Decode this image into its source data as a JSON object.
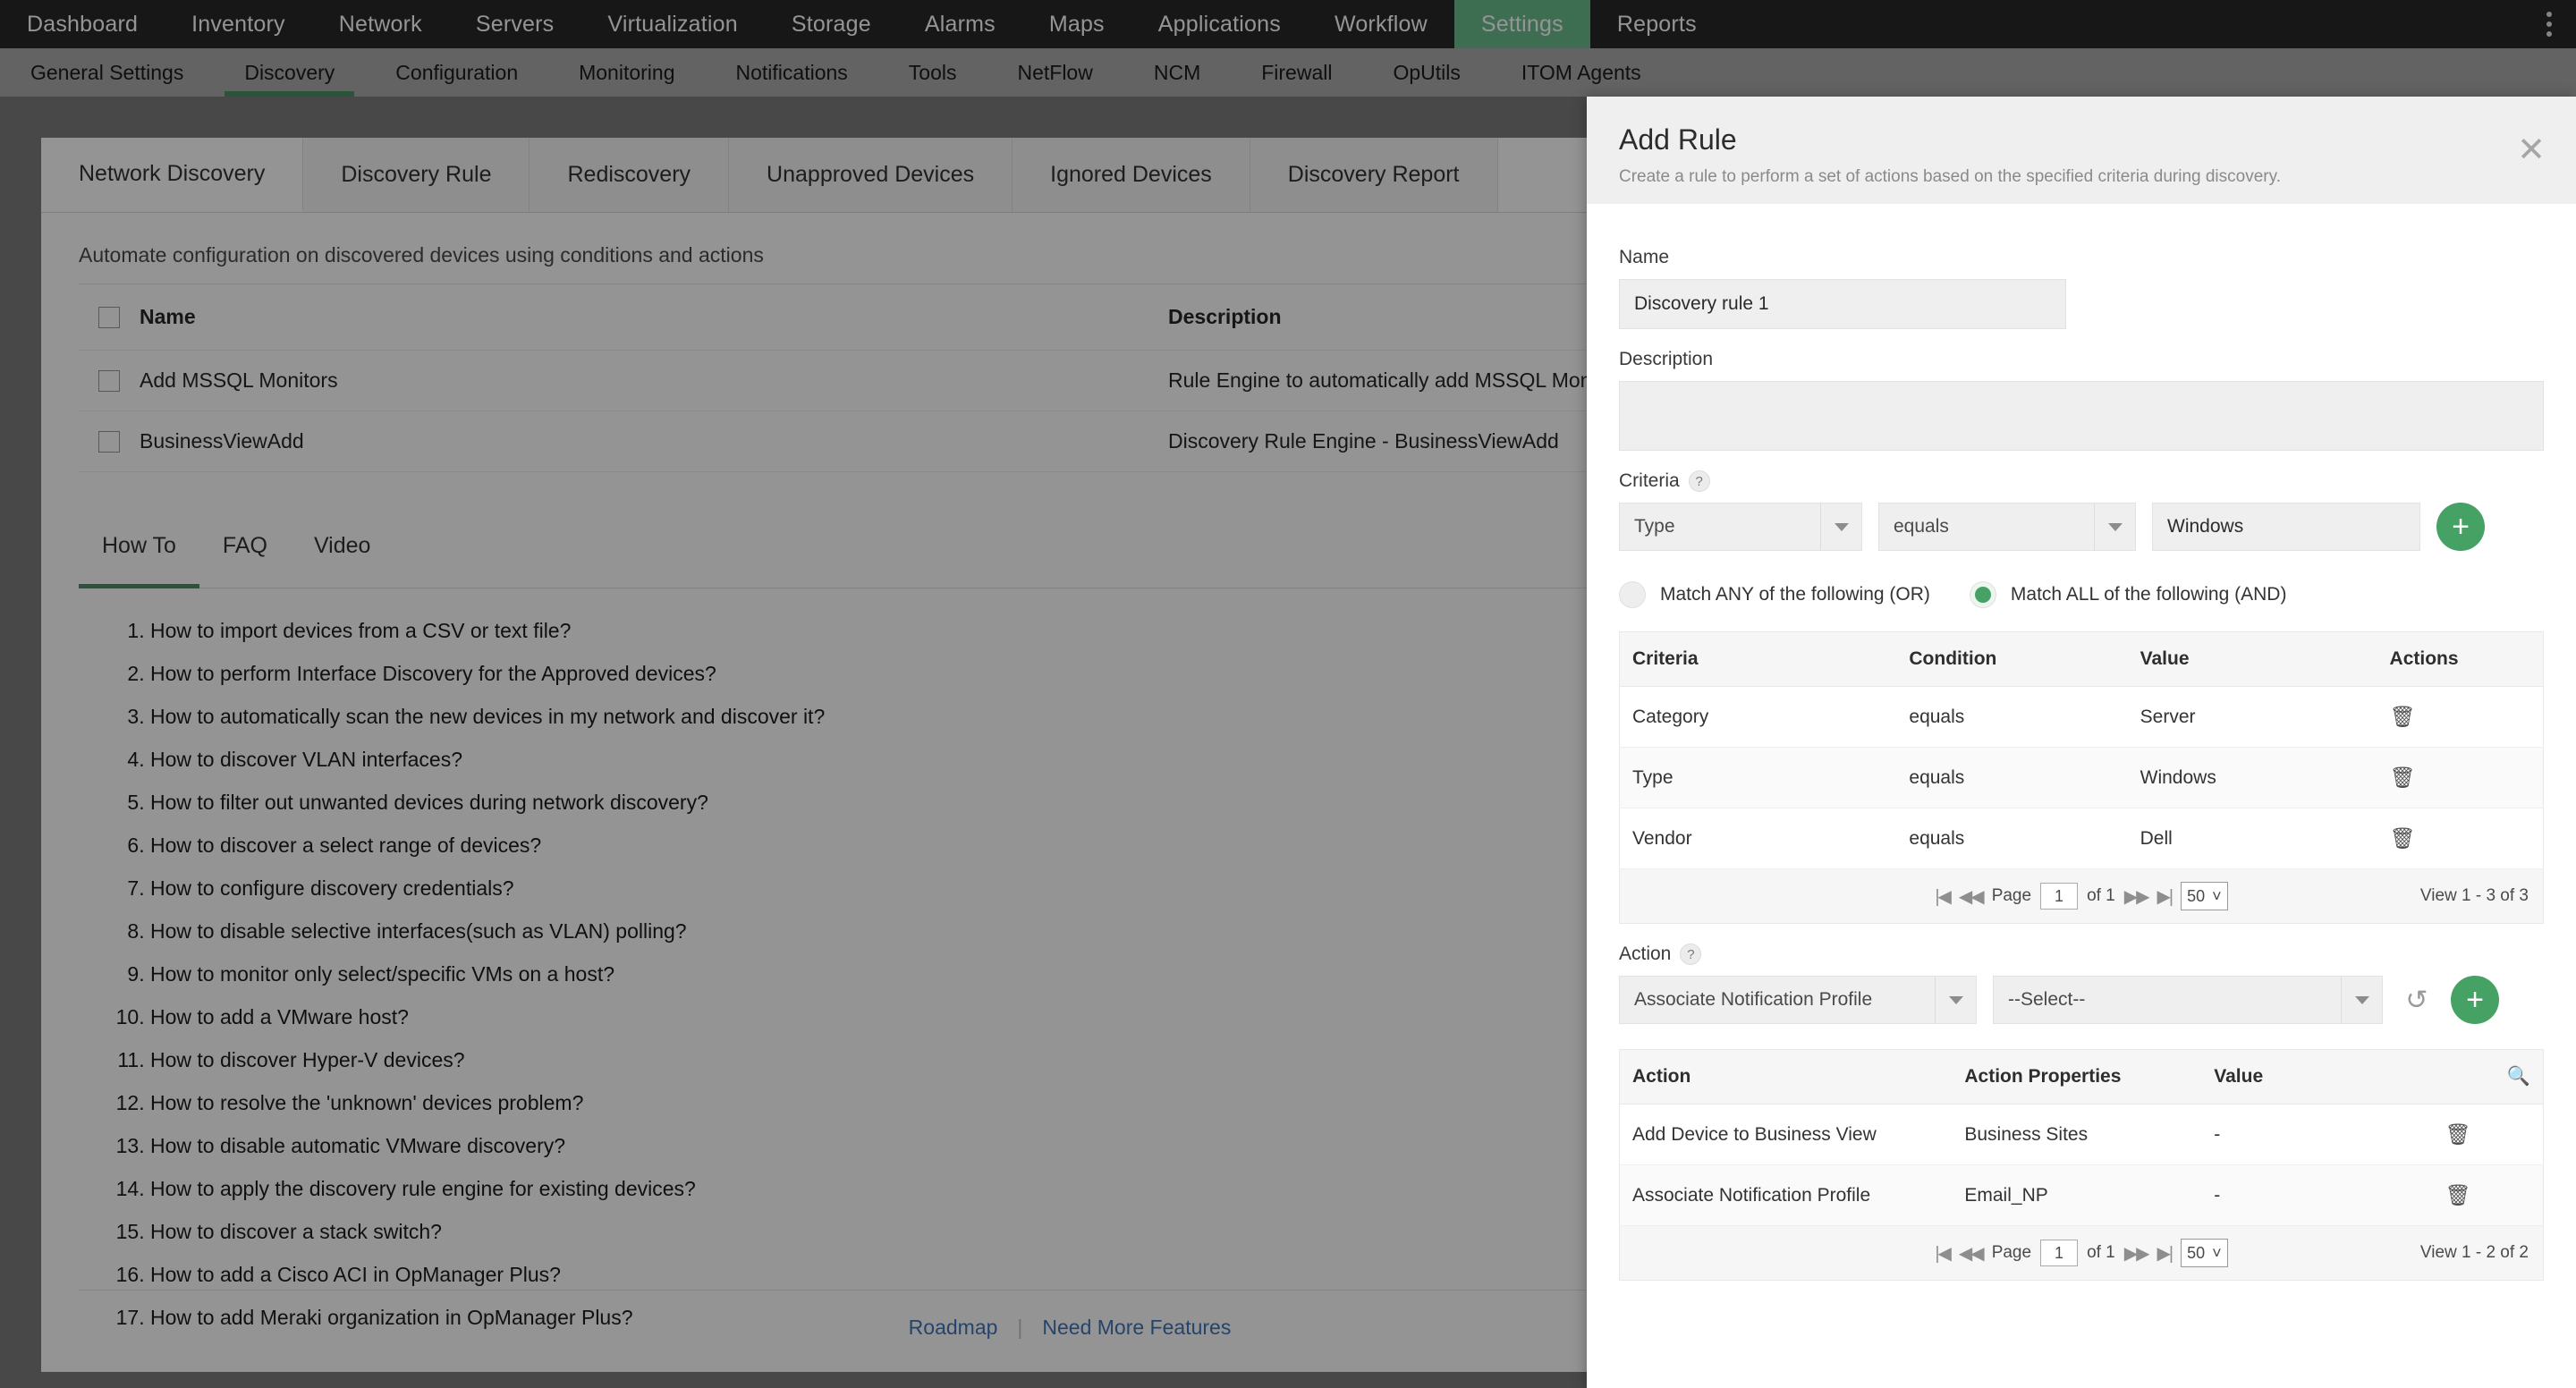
{
  "topnav": {
    "items": [
      {
        "label": "Dashboard",
        "active": false
      },
      {
        "label": "Inventory",
        "active": false
      },
      {
        "label": "Network",
        "active": false
      },
      {
        "label": "Servers",
        "active": false
      },
      {
        "label": "Virtualization",
        "active": false
      },
      {
        "label": "Storage",
        "active": false
      },
      {
        "label": "Alarms",
        "active": false
      },
      {
        "label": "Maps",
        "active": false
      },
      {
        "label": "Applications",
        "active": false
      },
      {
        "label": "Workflow",
        "active": false
      },
      {
        "label": "Settings",
        "active": true
      },
      {
        "label": "Reports",
        "active": false
      }
    ],
    "active_color": "#6cbe8e",
    "menu_icon": "kebab-menu-icon"
  },
  "subnav": {
    "items": [
      {
        "label": "General Settings",
        "active": false
      },
      {
        "label": "Discovery",
        "active": true
      },
      {
        "label": "Configuration",
        "active": false
      },
      {
        "label": "Monitoring",
        "active": false
      },
      {
        "label": "Notifications",
        "active": false
      },
      {
        "label": "Tools",
        "active": false
      },
      {
        "label": "NetFlow",
        "active": false
      },
      {
        "label": "NCM",
        "active": false
      },
      {
        "label": "Firewall",
        "active": false
      },
      {
        "label": "OpUtils",
        "active": false
      },
      {
        "label": "ITOM Agents",
        "active": false
      }
    ],
    "indicator_color": "#4d9167"
  },
  "content_tabs": [
    {
      "label": "Network Discovery",
      "active": true
    },
    {
      "label": "Discovery Rule",
      "active": false
    },
    {
      "label": "Rediscovery",
      "active": false
    },
    {
      "label": "Unapproved Devices",
      "active": false
    },
    {
      "label": "Ignored Devices",
      "active": false
    },
    {
      "label": "Discovery Report",
      "active": false
    }
  ],
  "main": {
    "subtitle": "Automate configuration on discovered devices using conditions and actions",
    "rules_table": {
      "headers": [
        "Name",
        "Description"
      ],
      "rows": [
        {
          "name": "Add MSSQL Monitors",
          "description": "Rule Engine to automatically add MSSQL Monitors"
        },
        {
          "name": "BusinessViewAdd",
          "description": "Discovery Rule Engine - BusinessViewAdd"
        }
      ]
    },
    "helper_tabs": [
      {
        "label": "How To",
        "active": true
      },
      {
        "label": "FAQ",
        "active": false
      },
      {
        "label": "Video",
        "active": false
      }
    ],
    "collapse_button": {
      "name": "minus-button",
      "color": "#7b2d2b"
    },
    "howto_items": [
      "How to import devices from a CSV or text file?",
      "How to perform Interface Discovery for the Approved devices?",
      "How to automatically scan the new devices in my network and discover it?",
      "How to discover VLAN interfaces?",
      "How to filter out unwanted devices during network discovery?",
      "How to discover a select range of devices?",
      "How to configure discovery credentials?",
      "How to disable selective interfaces(such as VLAN) polling?",
      "How to monitor only select/specific VMs on a host?",
      "How to add a VMware host?",
      "How to discover Hyper-V devices?",
      "How to resolve the 'unknown' devices problem?",
      "How to disable automatic VMware discovery?",
      "How to apply the discovery rule engine for existing devices?",
      "How to discover a stack switch?",
      "How to add a Cisco ACI in OpManager Plus?",
      "How to add Meraki organization in OpManager Plus?"
    ],
    "footer_links": [
      "Roadmap",
      "Need More Features"
    ],
    "footer_separator": "|"
  },
  "panel": {
    "title": "Add Rule",
    "subtitle": "Create a rule to perform a set of actions based on the specified criteria during discovery.",
    "close_icon": "close-icon",
    "name_label": "Name",
    "name_value": "Discovery rule 1",
    "description_label": "Description",
    "description_value": "",
    "criteria_label": "Criteria",
    "help_icon": "?",
    "criteria_field": "Type",
    "criteria_condition": "equals",
    "criteria_value": "Windows",
    "add_icon": "+",
    "match_any_label": "Match ANY of the following (OR)",
    "match_all_label": "Match ALL of the following (AND)",
    "match_selected": "all",
    "accent_color": "#45a164",
    "criteria_table": {
      "headers": [
        "Criteria",
        "Condition",
        "Value",
        "Actions"
      ],
      "rows": [
        {
          "criteria": "Category",
          "condition": "equals",
          "value": "Server",
          "action": "trash-icon"
        },
        {
          "criteria": "Type",
          "condition": "equals",
          "value": "Windows",
          "action": "trash-icon"
        },
        {
          "criteria": "Vendor",
          "condition": "equals",
          "value": "Dell",
          "action": "trash-icon"
        }
      ],
      "pager": {
        "first": "|◀",
        "prev": "◀◀",
        "page_label": "Page",
        "page_value": "1",
        "of_label": "of 1",
        "next": "▶▶",
        "last": "▶|",
        "page_size": "50",
        "view_label": "View 1 - 3 of 3"
      }
    },
    "action_label": "Action",
    "action_select": "Associate Notification Profile",
    "action_value_select": "--Select--",
    "refresh_icon": "undo-icon",
    "action_table": {
      "headers": [
        "Action",
        "Action Properties",
        "Value",
        ""
      ],
      "search_icon": "search-icon",
      "rows": [
        {
          "action": "Add Device to Business View",
          "properties": "Business Sites",
          "value": "-",
          "delete": "trash-icon"
        },
        {
          "action": "Associate Notification Profile",
          "properties": "Email_NP",
          "value": "-",
          "delete": "trash-icon"
        }
      ],
      "pager": {
        "first": "|◀",
        "prev": "◀◀",
        "page_label": "Page",
        "page_value": "1",
        "of_label": "of 1",
        "next": "▶▶",
        "last": "▶|",
        "page_size": "50",
        "view_label": "View 1 - 2 of 2"
      }
    }
  }
}
